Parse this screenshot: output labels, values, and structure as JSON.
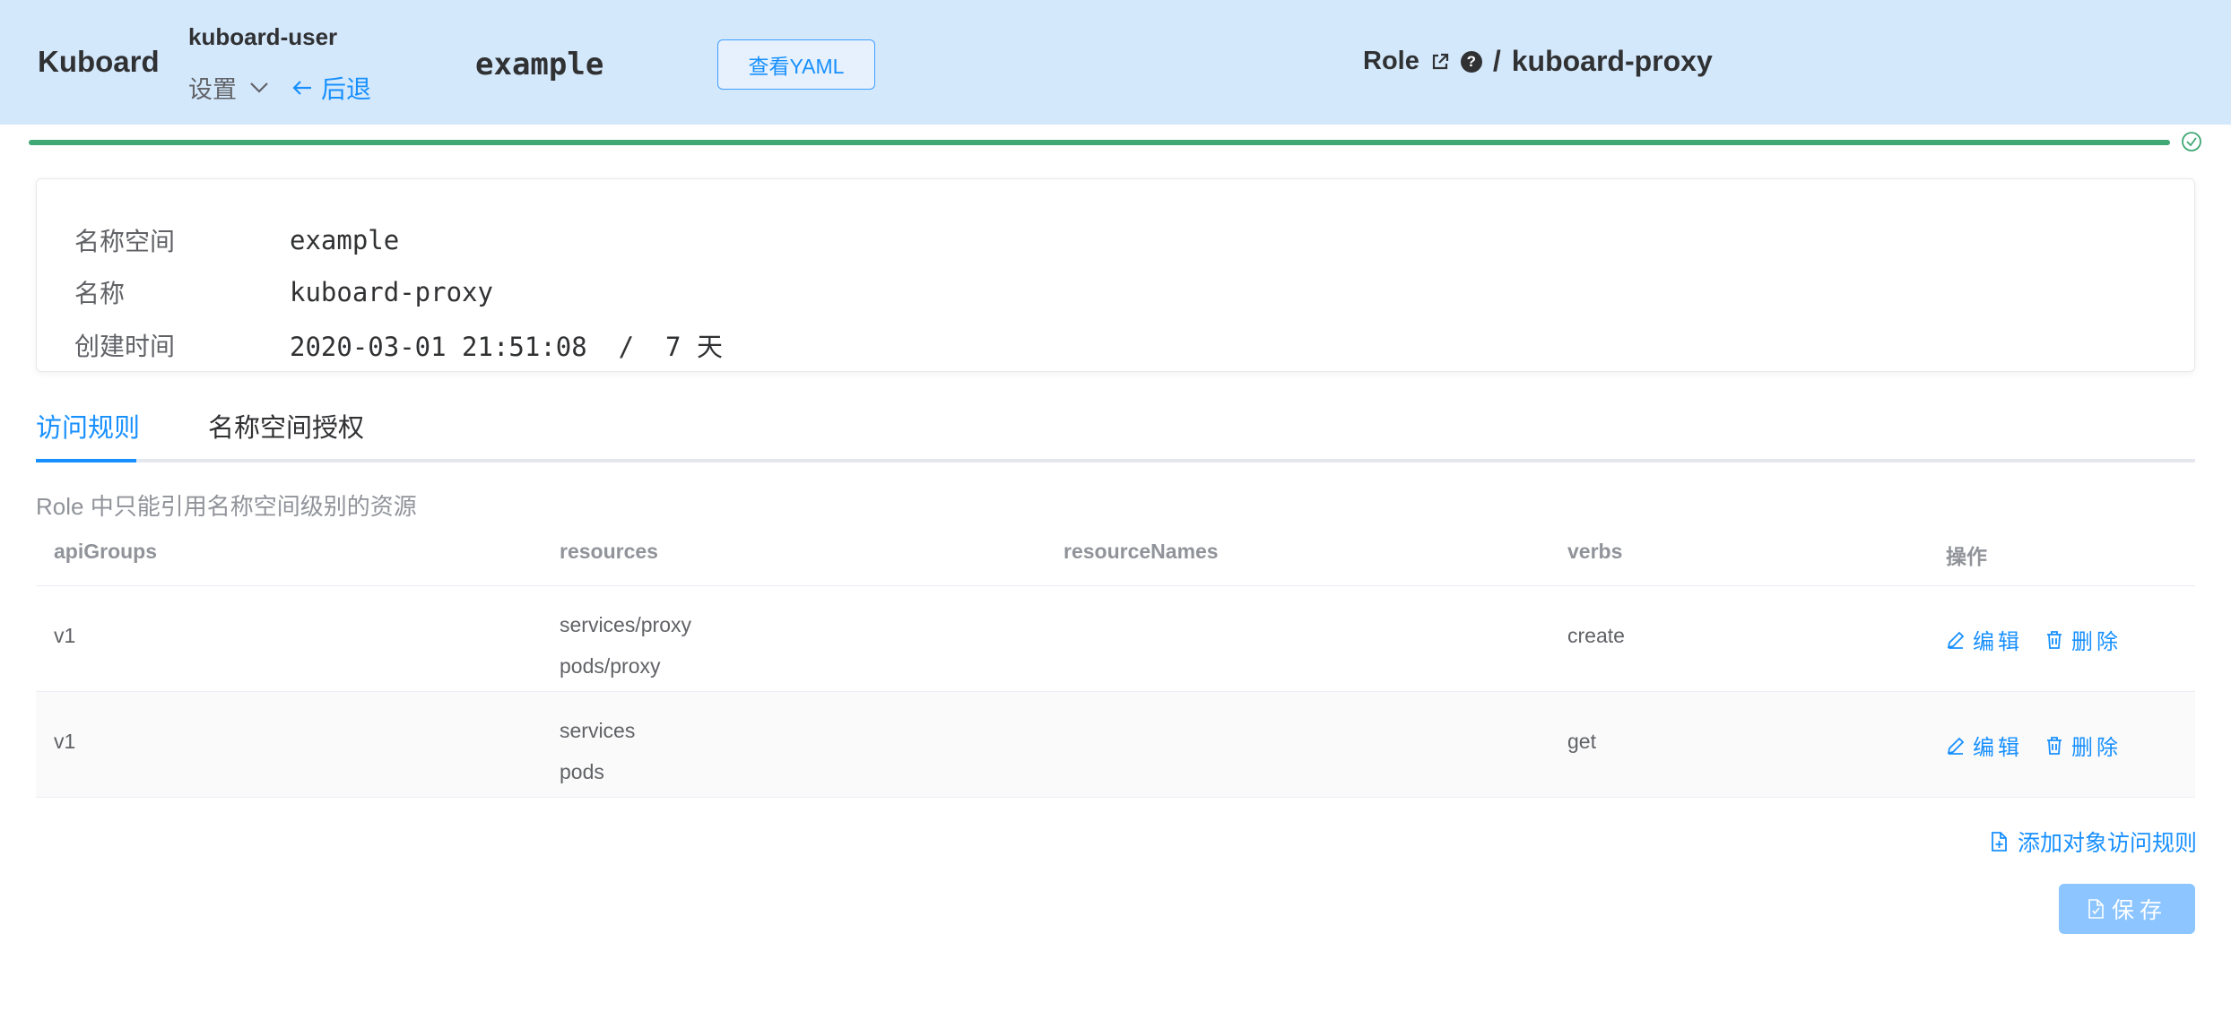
{
  "header": {
    "brand": "Kuboard",
    "user": "kuboard-user",
    "settings_label": "设置",
    "back_label": "后退",
    "namespace": "example",
    "view_yaml_label": "查看YAML",
    "resource_kind": "Role",
    "breadcrumb_separator": "/",
    "resource_name": "kuboard-proxy"
  },
  "progress": {
    "percent": 100,
    "status": "success",
    "color": "#3fa874"
  },
  "info": {
    "rows": [
      {
        "label": "名称空间",
        "value": "example"
      },
      {
        "label": "名称",
        "value": "kuboard-proxy"
      },
      {
        "label": "创建时间",
        "value": "2020-03-01 21:51:08  /  7 天"
      }
    ]
  },
  "tabs": [
    {
      "label": "访问规则",
      "active": true
    },
    {
      "label": "名称空间授权",
      "active": false
    }
  ],
  "hint": "Role 中只能引用名称空间级别的资源",
  "table": {
    "columns": [
      "apiGroups",
      "resources",
      "resourceNames",
      "verbs",
      "操作"
    ],
    "rows": [
      {
        "apiGroups": "v1",
        "resources": [
          "services/proxy",
          "pods/proxy"
        ],
        "resourceNames": "",
        "verbs": "create"
      },
      {
        "apiGroups": "v1",
        "resources": [
          "services",
          "pods"
        ],
        "resourceNames": "",
        "verbs": "get"
      }
    ],
    "edit_label": "编辑",
    "delete_label": "删除"
  },
  "actions": {
    "add_rule_label": "添加对象访问规则",
    "save_label": "保存"
  },
  "colors": {
    "header_bg": "#d4e8fc",
    "accent": "#1890ff",
    "success": "#3fa874",
    "save_disabled": "#8cc5ff"
  },
  "icons": [
    "chevron-down-icon",
    "arrow-left-icon",
    "external-link-icon",
    "question-circle-icon",
    "check-circle-icon",
    "edit-icon",
    "trash-icon",
    "file-add-icon",
    "file-icon"
  ]
}
